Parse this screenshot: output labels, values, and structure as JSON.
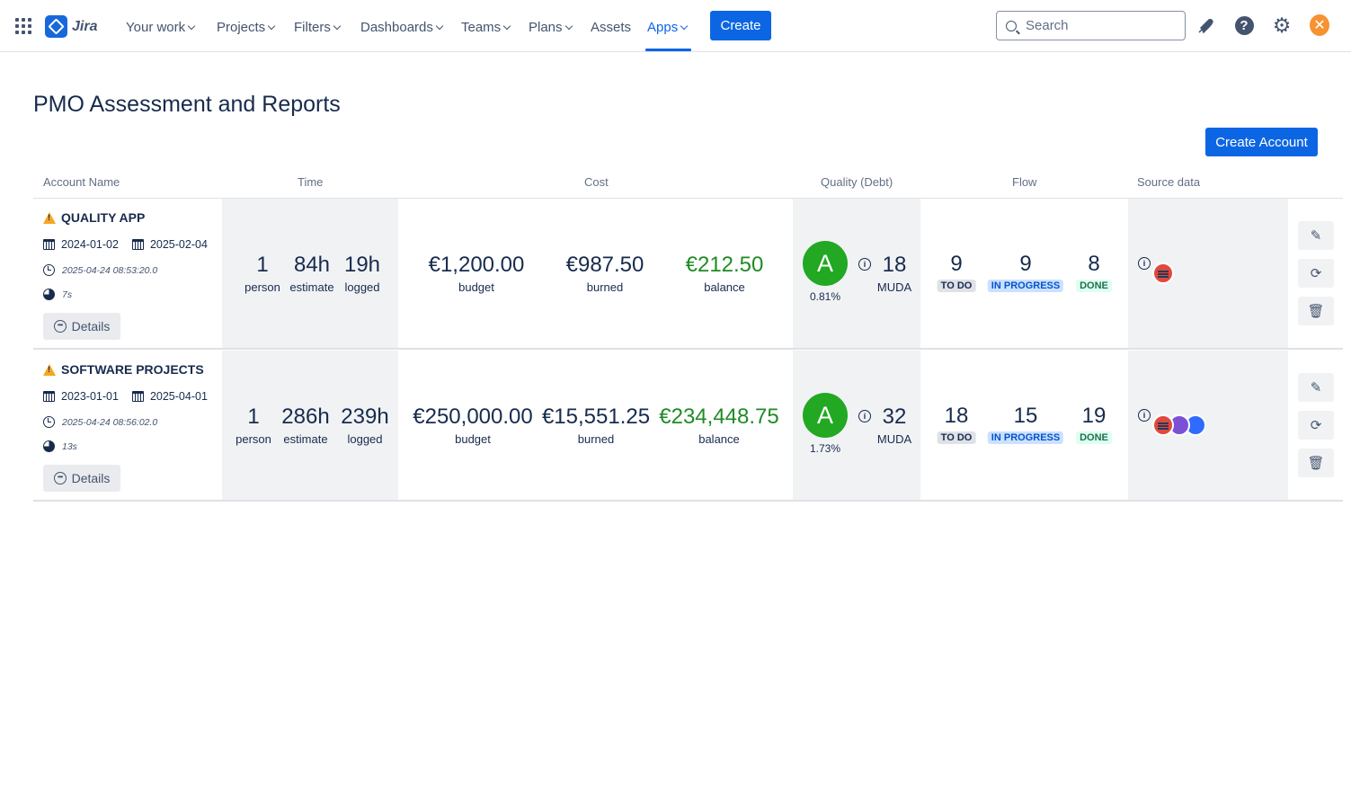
{
  "nav": {
    "app_name": "Jira",
    "items": [
      {
        "label": "Your work"
      },
      {
        "label": "Projects"
      },
      {
        "label": "Filters"
      },
      {
        "label": "Dashboards"
      },
      {
        "label": "Teams"
      },
      {
        "label": "Plans"
      },
      {
        "label": "Assets"
      },
      {
        "label": "Apps"
      }
    ],
    "active": "Apps",
    "create_label": "Create",
    "search_placeholder": "Search",
    "help_glyph": "?",
    "avatar_initial": "✕"
  },
  "page": {
    "title": "PMO Assessment and Reports",
    "create_account_label": "Create Account"
  },
  "table": {
    "headers": {
      "account": "Account Name",
      "time": "Time",
      "cost": "Cost",
      "quality": "Quality (Debt)",
      "flow": "Flow",
      "source": "Source data"
    },
    "details_label": "Details",
    "rows": [
      {
        "name": "QUALITY APP",
        "start": "2024-01-02",
        "end": "2025-02-04",
        "timestamp": "2025-04-24 08:53:20.0",
        "duration": "7s",
        "time": {
          "people": "1",
          "people_label": "person",
          "estimate": "84h",
          "estimate_label": "estimate",
          "logged": "19h",
          "logged_label": "logged"
        },
        "cost": {
          "budget": "€1,200.00",
          "budget_label": "budget",
          "burned": "€987.50",
          "burned_label": "burned",
          "balance": "€212.50",
          "balance_label": "balance"
        },
        "quality": {
          "grade": "A",
          "debt_pct": "0.81%",
          "muda": "18",
          "muda_label": "MUDA"
        },
        "flow": {
          "todo": "9",
          "todo_label": "TO DO",
          "in_progress": "9",
          "in_progress_label": "IN PROGRESS",
          "done": "8",
          "done_label": "DONE"
        },
        "sources": [
          "gitlab-icon"
        ]
      },
      {
        "name": "SOFTWARE PROJECTS",
        "start": "2023-01-01",
        "end": "2025-04-01",
        "timestamp": "2025-04-24 08:56:02.0",
        "duration": "13s",
        "time": {
          "people": "1",
          "people_label": "person",
          "estimate": "286h",
          "estimate_label": "estimate",
          "logged": "239h",
          "logged_label": "logged"
        },
        "cost": {
          "budget": "€250,000.00",
          "budget_label": "budget",
          "burned": "€15,551.25",
          "burned_label": "burned",
          "balance": "€234,448.75",
          "balance_label": "balance"
        },
        "quality": {
          "grade": "A",
          "debt_pct": "1.73%",
          "muda": "32",
          "muda_label": "MUDA"
        },
        "flow": {
          "todo": "18",
          "todo_label": "TO DO",
          "in_progress": "15",
          "in_progress_label": "IN PROGRESS",
          "done": "19",
          "done_label": "DONE"
        },
        "sources": [
          "gitlab-icon",
          "jira-icon",
          "confluence-icon"
        ]
      }
    ]
  },
  "colors": {
    "brand": "#0c66e4",
    "grade_green": "#22a822",
    "balance_green": "#1f8b24"
  }
}
